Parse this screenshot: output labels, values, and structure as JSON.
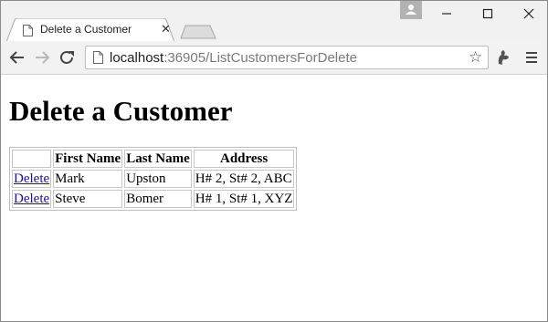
{
  "browser": {
    "tab_title": "Delete a Customer",
    "tab_close": "✕",
    "url_host": "localhost",
    "url_rest": ":36905/ListCustomersForDelete",
    "icons": {
      "back": "back-arrow-icon",
      "forward": "forward-arrow-icon",
      "reload": "reload-icon",
      "bookmark": "star-icon",
      "extension": "extension-icon",
      "menu": "hamburger-menu-icon"
    }
  },
  "page": {
    "heading": "Delete a Customer",
    "table": {
      "headers": [
        "",
        "First Name",
        "Last Name",
        "Address"
      ],
      "rows": [
        {
          "action": "Delete",
          "first": "Mark",
          "last": "Upston",
          "address": "H# 2, St# 2, ABC"
        },
        {
          "action": "Delete",
          "first": "Steve",
          "last": "Bomer",
          "address": "H# 1, St# 1, XYZ"
        }
      ]
    }
  },
  "colors": {
    "link": "#1a0dab",
    "chrome": "#f2f2f2"
  }
}
